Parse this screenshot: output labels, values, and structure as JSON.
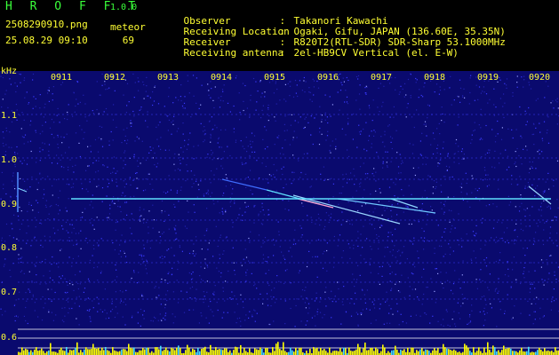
{
  "header": {
    "app_name": "H R O F F T",
    "app_version": "1.0.0",
    "filename": "2508290910.png",
    "datetime": "25.08.29 09:10",
    "meteor_label": "meteor",
    "meteor_count": "69"
  },
  "info": [
    {
      "key": "Observer",
      "sep": ":",
      "value": "Takanori Kawachi"
    },
    {
      "key": "Receiving Location",
      "sep": ":",
      "value": "Ogaki, Gifu, JAPAN (136.60E, 35.35N)"
    },
    {
      "key": "Receiver",
      "sep": ":",
      "value": "R820T2(RTL-SDR) SDR-Sharp 53.1000MHz"
    },
    {
      "key": "Receiving antenna",
      "sep": ":",
      "value": "2el-HB9CV Vertical (el. E-W)"
    }
  ],
  "spectrogram": {
    "y_unit": "kHz",
    "y_ticks": [
      "1.1",
      "1.0",
      "0.9",
      "0.8",
      "0.7",
      "0.6"
    ],
    "x_ticks": [
      "0911",
      "0912",
      "0913",
      "0914",
      "0915",
      "0916",
      "0917",
      "0918",
      "0919",
      "0920"
    ],
    "colors": {
      "background": "#0a0a6e",
      "noise": "#3a3aff",
      "carrier": "#5fe0ff",
      "axis_text": "#ffff33",
      "grid": "#ffffff",
      "level_bar": "#ffff00"
    }
  }
}
